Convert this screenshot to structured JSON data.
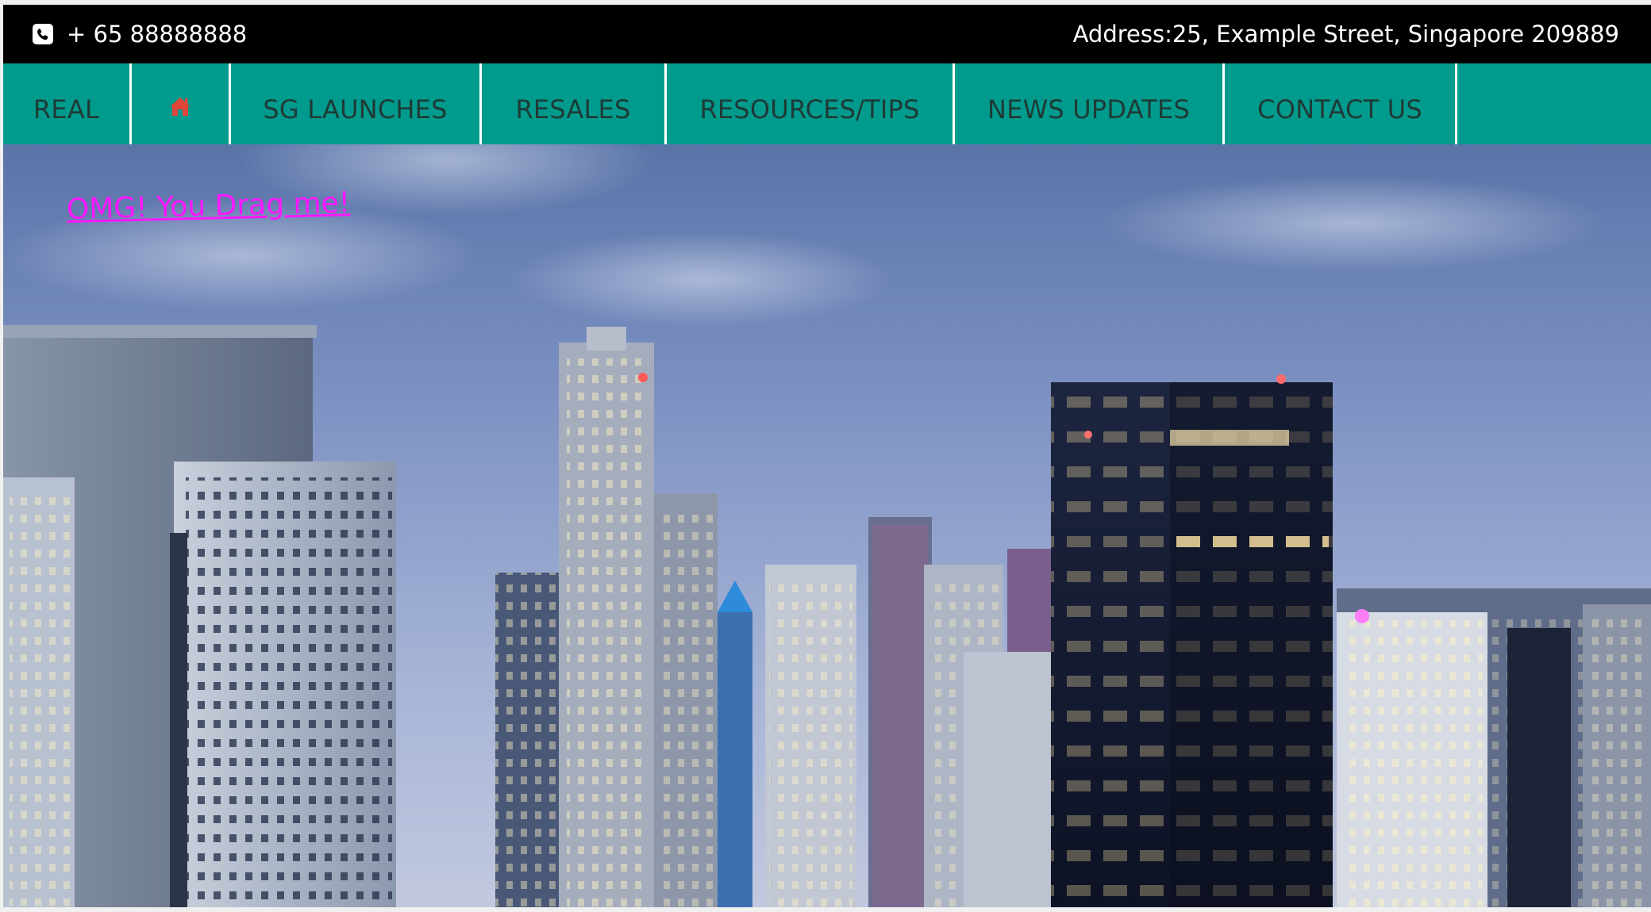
{
  "topbar": {
    "phone_icon": "phone-icon",
    "phone": "+ 65 88888888",
    "address": "Address:25, Example Street, Singapore 209889"
  },
  "nav": {
    "items": [
      {
        "label": "REAL"
      },
      {
        "label": "",
        "icon": "home-icon"
      },
      {
        "label": "SG LAUNCHES"
      },
      {
        "label": "RESALES"
      },
      {
        "label": "RESOURCES/TIPS"
      },
      {
        "label": "NEWS UPDATES"
      },
      {
        "label": "CONTACT US"
      }
    ]
  },
  "hero": {
    "drag_text": "OMG! You Drag me!"
  },
  "colors": {
    "topbar_bg": "#000000",
    "nav_bg": "#009b8c",
    "nav_text": "#1f3a36",
    "home_icon": "#e0453a",
    "drag_link": "#ff17ff"
  }
}
